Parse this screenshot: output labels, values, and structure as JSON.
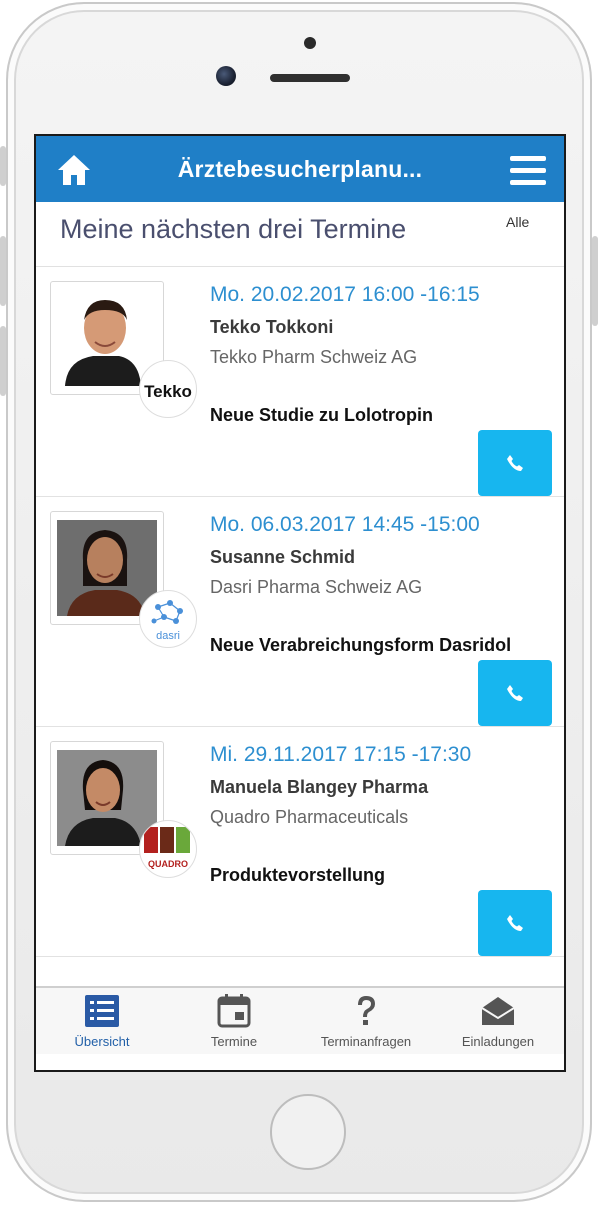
{
  "header": {
    "title": "Ärztebesucherplanu..."
  },
  "section": {
    "title": "Meine nächsten drei Termine",
    "all_label": "Alle"
  },
  "appointments": [
    {
      "datetime": "Mo. 20.02.2017 16:00 -16:15",
      "person": "Tekko Tokkoni",
      "company": "Tekko Pharm Schweiz AG",
      "topic": "Neue Studie zu Lolotropin",
      "badge": "Tekko"
    },
    {
      "datetime": "Mo. 06.03.2017 14:45 -15:00",
      "person": "Susanne Schmid",
      "company": "Dasri Pharma Schweiz AG",
      "topic": "Neue Verabreichungsform Dasridol",
      "badge": "dasri"
    },
    {
      "datetime": "Mi. 29.11.2017 17:15 -17:30",
      "person": "Manuela Blangey Pharma",
      "company": "Quadro Pharmaceuticals",
      "topic": "Produktevorstellung",
      "badge": "QUADRO"
    }
  ],
  "tabs": [
    {
      "label": "Übersicht",
      "icon": "list-icon"
    },
    {
      "label": "Termine",
      "icon": "calendar-icon"
    },
    {
      "label": "Terminanfragen",
      "icon": "question-icon"
    },
    {
      "label": "Einladungen",
      "icon": "envelope-icon"
    }
  ],
  "colors": {
    "header": "#1f7fc7",
    "accent": "#2d8fd0",
    "call_button": "#17b6ef",
    "active_tab": "#2260a8"
  }
}
